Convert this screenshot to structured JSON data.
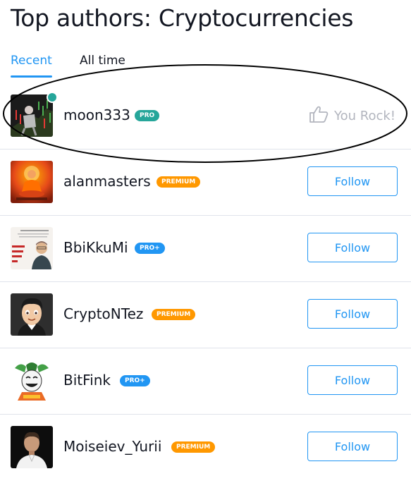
{
  "page": {
    "title": "Top authors: Cryptocurrencies"
  },
  "tabs": [
    {
      "label": "Recent",
      "active": true
    },
    {
      "label": "All time",
      "active": false
    }
  ],
  "authors": [
    {
      "username": "moon333",
      "badge": "PRO",
      "badge_type": "pro",
      "online": true,
      "action": "You Rock!",
      "action_type": "rock"
    },
    {
      "username": "alanmasters",
      "badge": "PREMIUM",
      "badge_type": "premium",
      "online": false,
      "action": "Follow",
      "action_type": "follow"
    },
    {
      "username": "BbiKkuMi",
      "badge": "PRO+",
      "badge_type": "proplus",
      "online": false,
      "action": "Follow",
      "action_type": "follow"
    },
    {
      "username": "CryptoNTez",
      "badge": "PREMIUM",
      "badge_type": "premium",
      "online": false,
      "action": "Follow",
      "action_type": "follow"
    },
    {
      "username": "BitFink",
      "badge": "PRO+",
      "badge_type": "proplus",
      "online": false,
      "action": "Follow",
      "action_type": "follow"
    },
    {
      "username": "Moiseiev_Yurii",
      "badge": "PREMIUM",
      "badge_type": "premium",
      "online": false,
      "action": "Follow",
      "action_type": "follow"
    }
  ],
  "colors": {
    "accent": "#2196f3",
    "pro_badge": "#26a69a",
    "premium_badge": "#ff9800",
    "online": "#26a69a",
    "rock_text": "#b2b5be"
  }
}
